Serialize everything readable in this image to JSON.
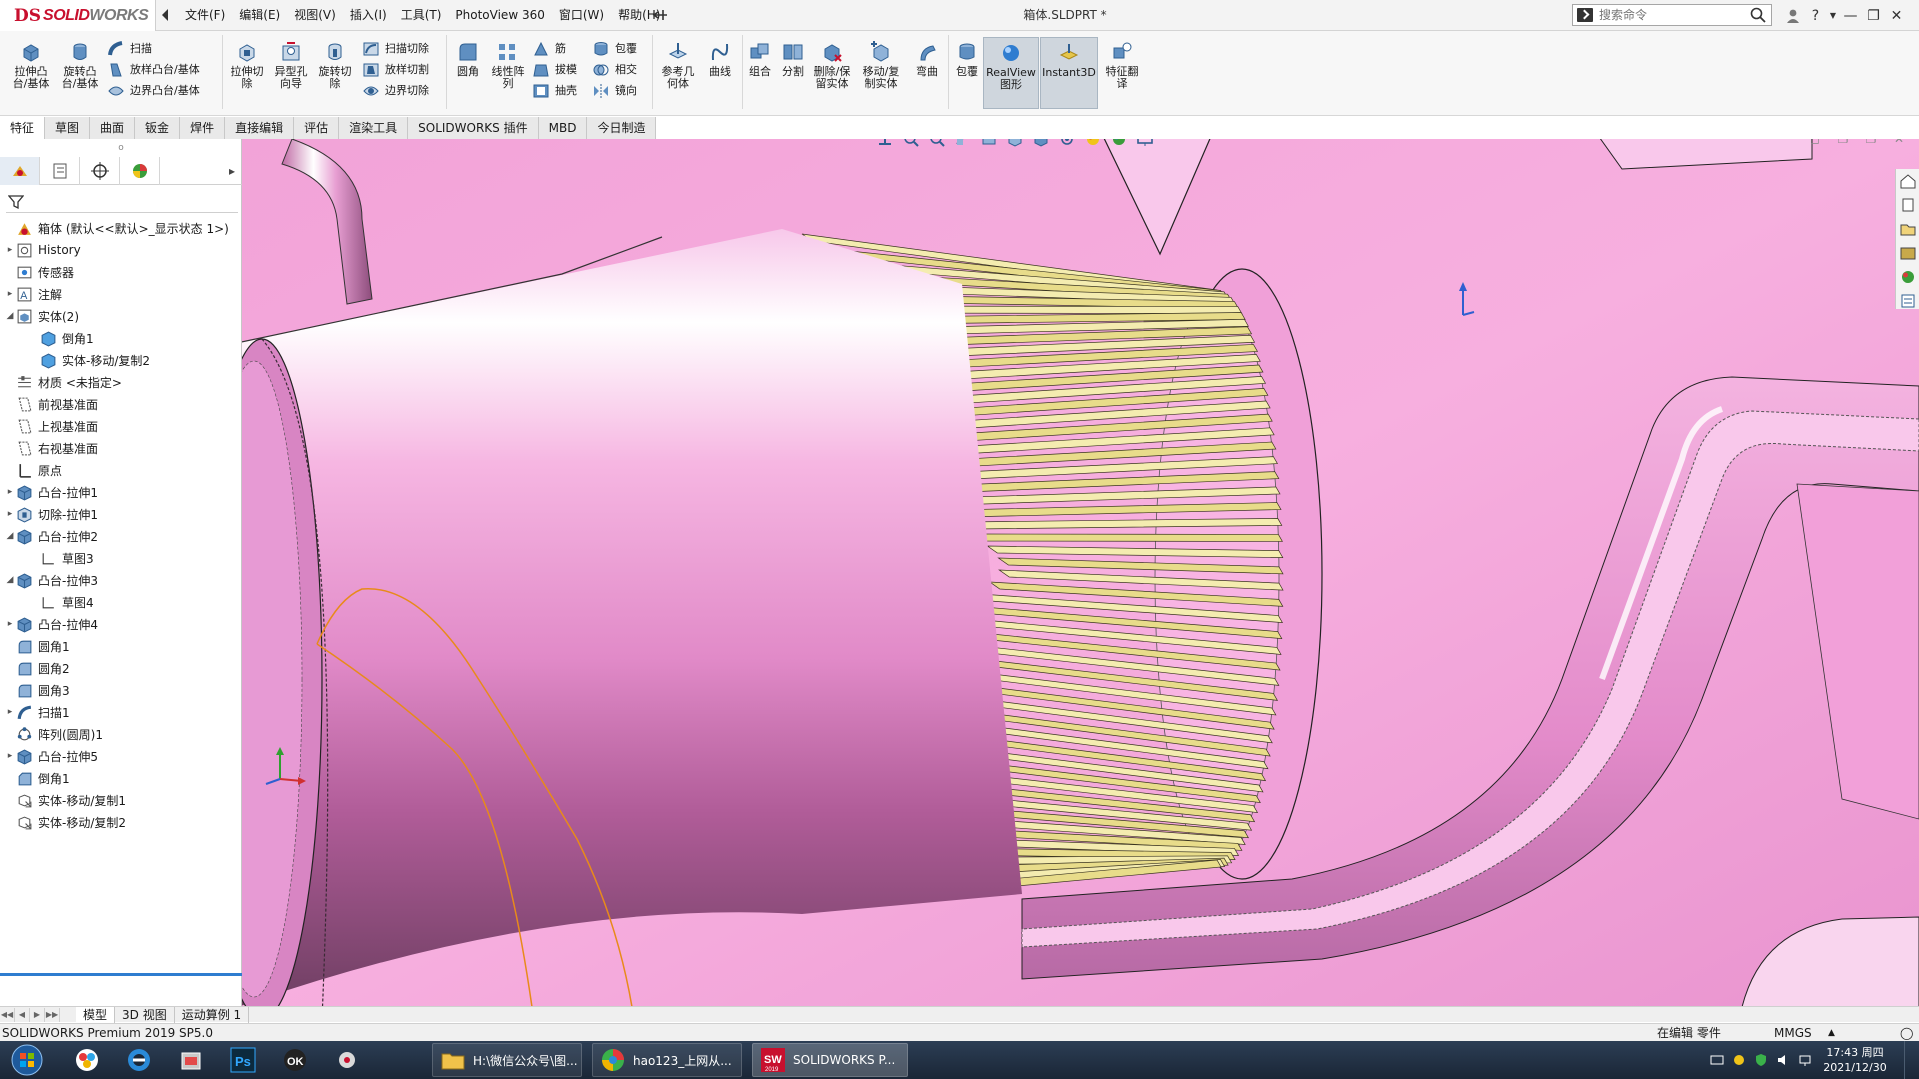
{
  "app": {
    "brand_ds": "DS",
    "brand_solid": "SOLID",
    "brand_works": "WORKS",
    "document_title": "箱体.SLDPRT *"
  },
  "menu": [
    "文件(F)",
    "编辑(E)",
    "视图(V)",
    "插入(I)",
    "工具(T)",
    "PhotoView 360",
    "窗口(W)",
    "帮助(H)"
  ],
  "search": {
    "placeholder": "搜索命令"
  },
  "ribbon": {
    "extrude_boss": "拉伸凸\n台/基体",
    "revolve_boss": "旋转凸\n台/基体",
    "sweep": "扫描",
    "loft": "放样凸台/基体",
    "boundary_boss": "边界凸台/基体",
    "extrude_cut": "拉伸切\n除",
    "hole_wizard": "异型孔\n向导",
    "revolve_cut": "旋转切\n除",
    "swept_cut": "扫描切除",
    "lofted_cut": "放样切割",
    "boundary_cut": "边界切除",
    "fillet": "圆角",
    "linear_pattern": "线性阵\n列",
    "rib": "筋",
    "draft": "拔模",
    "shell": "抽壳",
    "wrap": "包覆",
    "intersect": "相交",
    "mirror": "镜向",
    "ref_geometry": "参考几\n何体",
    "curves": "曲线",
    "combine": "组合",
    "split": "分割",
    "delete_keep_body": "删除/保\n留实体",
    "move_copy_body": "移动/复\n制实体",
    "flex": "弯曲",
    "indent": "包覆",
    "realview": "RealView\n图形",
    "instant3d": "Instant3D",
    "feature_translate": "特征翻\n译"
  },
  "tabs": [
    {
      "label": "特征",
      "active": true
    },
    {
      "label": "草图",
      "active": false
    },
    {
      "label": "曲面",
      "active": false
    },
    {
      "label": "钣金",
      "active": false
    },
    {
      "label": "焊件",
      "active": false
    },
    {
      "label": "直接编辑",
      "active": false
    },
    {
      "label": "评估",
      "active": false
    },
    {
      "label": "渲染工具",
      "active": false
    },
    {
      "label": "SOLIDWORKS 插件",
      "active": false
    },
    {
      "label": "MBD",
      "active": false
    },
    {
      "label": "今日制造",
      "active": false
    }
  ],
  "tree": [
    {
      "label": "箱体 (默认<<默认>_显示状态 1>)",
      "icon": "part-icon",
      "indent": 0,
      "expander": "",
      "root": true
    },
    {
      "label": "History",
      "icon": "history-icon",
      "indent": 0,
      "expander": "collapsed"
    },
    {
      "label": "传感器",
      "icon": "sensor-icon",
      "indent": 0,
      "expander": ""
    },
    {
      "label": "注解",
      "icon": "annotation-icon",
      "indent": 0,
      "expander": "collapsed"
    },
    {
      "label": "实体(2)",
      "icon": "solid-bodies-folder-icon",
      "indent": 0,
      "expander": "expanded"
    },
    {
      "label": "倒角1",
      "icon": "solid-body-icon",
      "indent": 1,
      "expander": ""
    },
    {
      "label": "实体-移动/复制2",
      "icon": "solid-body-icon",
      "indent": 1,
      "expander": ""
    },
    {
      "label": "材质 <未指定>",
      "icon": "material-icon",
      "indent": 0,
      "expander": ""
    },
    {
      "label": "前视基准面",
      "icon": "plane-icon",
      "indent": 0,
      "expander": ""
    },
    {
      "label": "上视基准面",
      "icon": "plane-icon",
      "indent": 0,
      "expander": ""
    },
    {
      "label": "右视基准面",
      "icon": "plane-icon",
      "indent": 0,
      "expander": ""
    },
    {
      "label": "原点",
      "icon": "origin-icon",
      "indent": 0,
      "expander": ""
    },
    {
      "label": "凸台-拉伸1",
      "icon": "boss-extrude-icon",
      "indent": 0,
      "expander": "collapsed"
    },
    {
      "label": "切除-拉伸1",
      "icon": "cut-extrude-icon",
      "indent": 0,
      "expander": "collapsed"
    },
    {
      "label": "凸台-拉伸2",
      "icon": "boss-extrude-icon",
      "indent": 0,
      "expander": "expanded"
    },
    {
      "label": "草图3",
      "icon": "sketch-icon",
      "indent": 1,
      "expander": ""
    },
    {
      "label": "凸台-拉伸3",
      "icon": "boss-extrude-icon",
      "indent": 0,
      "expander": "expanded"
    },
    {
      "label": "草图4",
      "icon": "sketch-icon",
      "indent": 1,
      "expander": ""
    },
    {
      "label": "凸台-拉伸4",
      "icon": "boss-extrude-icon",
      "indent": 0,
      "expander": "collapsed"
    },
    {
      "label": "圆角1",
      "icon": "fillet-icon",
      "indent": 0,
      "expander": ""
    },
    {
      "label": "圆角2",
      "icon": "fillet-icon",
      "indent": 0,
      "expander": ""
    },
    {
      "label": "圆角3",
      "icon": "fillet-icon",
      "indent": 0,
      "expander": ""
    },
    {
      "label": "扫描1",
      "icon": "sweep-icon",
      "indent": 0,
      "expander": "collapsed"
    },
    {
      "label": "阵列(圆周)1",
      "icon": "circular-pattern-icon",
      "indent": 0,
      "expander": ""
    },
    {
      "label": "凸台-拉伸5",
      "icon": "boss-extrude-icon",
      "indent": 0,
      "expander": "collapsed"
    },
    {
      "label": "倒角1",
      "icon": "chamfer-icon",
      "indent": 0,
      "expander": ""
    },
    {
      "label": "实体-移动/复制1",
      "icon": "move-copy-body-icon",
      "indent": 0,
      "expander": ""
    },
    {
      "label": "实体-移动/复制2",
      "icon": "move-copy-body-icon",
      "indent": 0,
      "expander": ""
    }
  ],
  "bottom_tabs": [
    {
      "label": "模型",
      "active": true
    },
    {
      "label": "3D 视图",
      "active": false
    },
    {
      "label": "运动算例 1",
      "active": false
    }
  ],
  "status": {
    "product": "SOLIDWORKS Premium 2019 SP5.0",
    "mode": "在编辑 零件",
    "units": "MMGS"
  },
  "taskbar": {
    "tasks": [
      {
        "label": "H:\\微信公众号\\图...",
        "icon": "folder-icon"
      },
      {
        "label": "hao123_上网从...",
        "icon": "browser-icon"
      },
      {
        "label": "SOLIDWORKS P...",
        "icon": "solidworks-icon"
      }
    ],
    "sw_badge": "2019",
    "clock_time": "17:43 周四",
    "clock_date": "2021/12/30"
  },
  "colors": {
    "model_pink": "#f6a9dc",
    "spline_gold": "#e8dc8a",
    "sketch_orange": "#e88a1a",
    "selection_blue": "#2f7dd0"
  }
}
